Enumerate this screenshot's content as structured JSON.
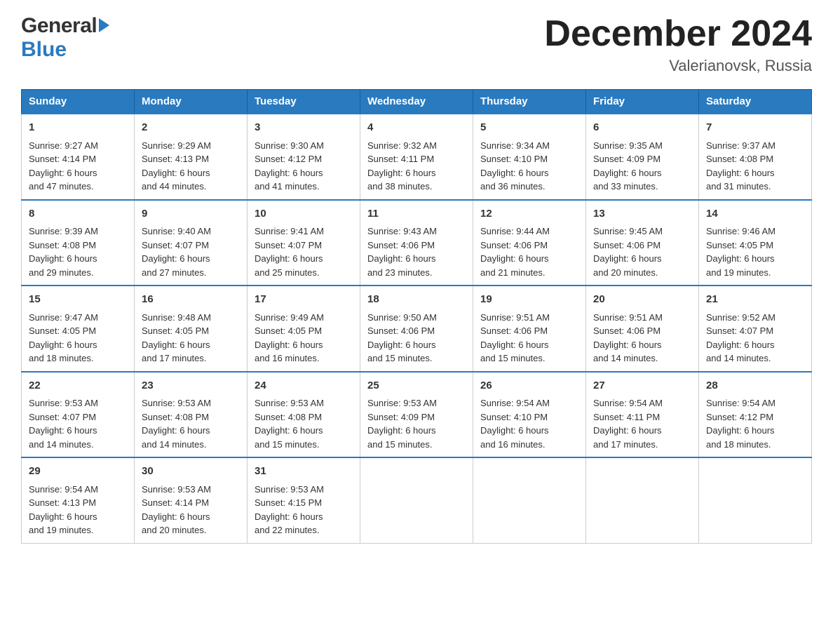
{
  "header": {
    "title": "December 2024",
    "subtitle": "Valerianovsk, Russia",
    "logo_general": "General",
    "logo_blue": "Blue"
  },
  "weekdays": [
    "Sunday",
    "Monday",
    "Tuesday",
    "Wednesday",
    "Thursday",
    "Friday",
    "Saturday"
  ],
  "weeks": [
    [
      {
        "day": "1",
        "sunrise": "9:27 AM",
        "sunset": "4:14 PM",
        "daylight": "6 hours and 47 minutes."
      },
      {
        "day": "2",
        "sunrise": "9:29 AM",
        "sunset": "4:13 PM",
        "daylight": "6 hours and 44 minutes."
      },
      {
        "day": "3",
        "sunrise": "9:30 AM",
        "sunset": "4:12 PM",
        "daylight": "6 hours and 41 minutes."
      },
      {
        "day": "4",
        "sunrise": "9:32 AM",
        "sunset": "4:11 PM",
        "daylight": "6 hours and 38 minutes."
      },
      {
        "day": "5",
        "sunrise": "9:34 AM",
        "sunset": "4:10 PM",
        "daylight": "6 hours and 36 minutes."
      },
      {
        "day": "6",
        "sunrise": "9:35 AM",
        "sunset": "4:09 PM",
        "daylight": "6 hours and 33 minutes."
      },
      {
        "day": "7",
        "sunrise": "9:37 AM",
        "sunset": "4:08 PM",
        "daylight": "6 hours and 31 minutes."
      }
    ],
    [
      {
        "day": "8",
        "sunrise": "9:39 AM",
        "sunset": "4:08 PM",
        "daylight": "6 hours and 29 minutes."
      },
      {
        "day": "9",
        "sunrise": "9:40 AM",
        "sunset": "4:07 PM",
        "daylight": "6 hours and 27 minutes."
      },
      {
        "day": "10",
        "sunrise": "9:41 AM",
        "sunset": "4:07 PM",
        "daylight": "6 hours and 25 minutes."
      },
      {
        "day": "11",
        "sunrise": "9:43 AM",
        "sunset": "4:06 PM",
        "daylight": "6 hours and 23 minutes."
      },
      {
        "day": "12",
        "sunrise": "9:44 AM",
        "sunset": "4:06 PM",
        "daylight": "6 hours and 21 minutes."
      },
      {
        "day": "13",
        "sunrise": "9:45 AM",
        "sunset": "4:06 PM",
        "daylight": "6 hours and 20 minutes."
      },
      {
        "day": "14",
        "sunrise": "9:46 AM",
        "sunset": "4:05 PM",
        "daylight": "6 hours and 19 minutes."
      }
    ],
    [
      {
        "day": "15",
        "sunrise": "9:47 AM",
        "sunset": "4:05 PM",
        "daylight": "6 hours and 18 minutes."
      },
      {
        "day": "16",
        "sunrise": "9:48 AM",
        "sunset": "4:05 PM",
        "daylight": "6 hours and 17 minutes."
      },
      {
        "day": "17",
        "sunrise": "9:49 AM",
        "sunset": "4:05 PM",
        "daylight": "6 hours and 16 minutes."
      },
      {
        "day": "18",
        "sunrise": "9:50 AM",
        "sunset": "4:06 PM",
        "daylight": "6 hours and 15 minutes."
      },
      {
        "day": "19",
        "sunrise": "9:51 AM",
        "sunset": "4:06 PM",
        "daylight": "6 hours and 15 minutes."
      },
      {
        "day": "20",
        "sunrise": "9:51 AM",
        "sunset": "4:06 PM",
        "daylight": "6 hours and 14 minutes."
      },
      {
        "day": "21",
        "sunrise": "9:52 AM",
        "sunset": "4:07 PM",
        "daylight": "6 hours and 14 minutes."
      }
    ],
    [
      {
        "day": "22",
        "sunrise": "9:53 AM",
        "sunset": "4:07 PM",
        "daylight": "6 hours and 14 minutes."
      },
      {
        "day": "23",
        "sunrise": "9:53 AM",
        "sunset": "4:08 PM",
        "daylight": "6 hours and 14 minutes."
      },
      {
        "day": "24",
        "sunrise": "9:53 AM",
        "sunset": "4:08 PM",
        "daylight": "6 hours and 15 minutes."
      },
      {
        "day": "25",
        "sunrise": "9:53 AM",
        "sunset": "4:09 PM",
        "daylight": "6 hours and 15 minutes."
      },
      {
        "day": "26",
        "sunrise": "9:54 AM",
        "sunset": "4:10 PM",
        "daylight": "6 hours and 16 minutes."
      },
      {
        "day": "27",
        "sunrise": "9:54 AM",
        "sunset": "4:11 PM",
        "daylight": "6 hours and 17 minutes."
      },
      {
        "day": "28",
        "sunrise": "9:54 AM",
        "sunset": "4:12 PM",
        "daylight": "6 hours and 18 minutes."
      }
    ],
    [
      {
        "day": "29",
        "sunrise": "9:54 AM",
        "sunset": "4:13 PM",
        "daylight": "6 hours and 19 minutes."
      },
      {
        "day": "30",
        "sunrise": "9:53 AM",
        "sunset": "4:14 PM",
        "daylight": "6 hours and 20 minutes."
      },
      {
        "day": "31",
        "sunrise": "9:53 AM",
        "sunset": "4:15 PM",
        "daylight": "6 hours and 22 minutes."
      },
      null,
      null,
      null,
      null
    ]
  ],
  "labels": {
    "sunrise": "Sunrise:",
    "sunset": "Sunset:",
    "daylight": "Daylight:"
  }
}
